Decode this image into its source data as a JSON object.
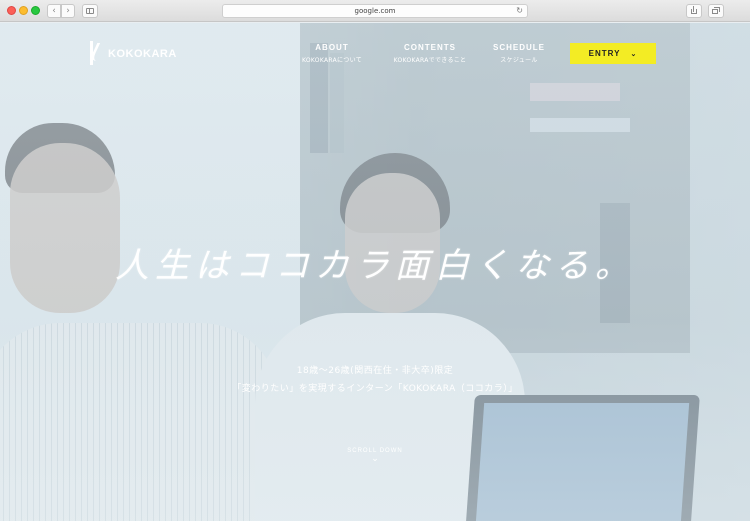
{
  "browser": {
    "url": "google.com"
  },
  "header": {
    "logo_text": "KOKOKARA",
    "nav": [
      {
        "en": "ABOUT",
        "jp": "KOKOKARAについて"
      },
      {
        "en": "CONTENTS",
        "jp": "KOKOKARAでできること"
      },
      {
        "en": "SCHEDULE",
        "jp": "スケジュール"
      }
    ],
    "entry_label": "ENTRY",
    "entry_color": "#f3ec24"
  },
  "hero": {
    "tagline": "人生はココカラ面白くなる。",
    "subtitle_line1": "18歳～26歳(関西在住・非大卒)限定",
    "subtitle_line2": "「変わりたい」を実現するインターン「KOKOKARA（ココカラ）」",
    "scroll_label": "SCROLL DOWN"
  }
}
